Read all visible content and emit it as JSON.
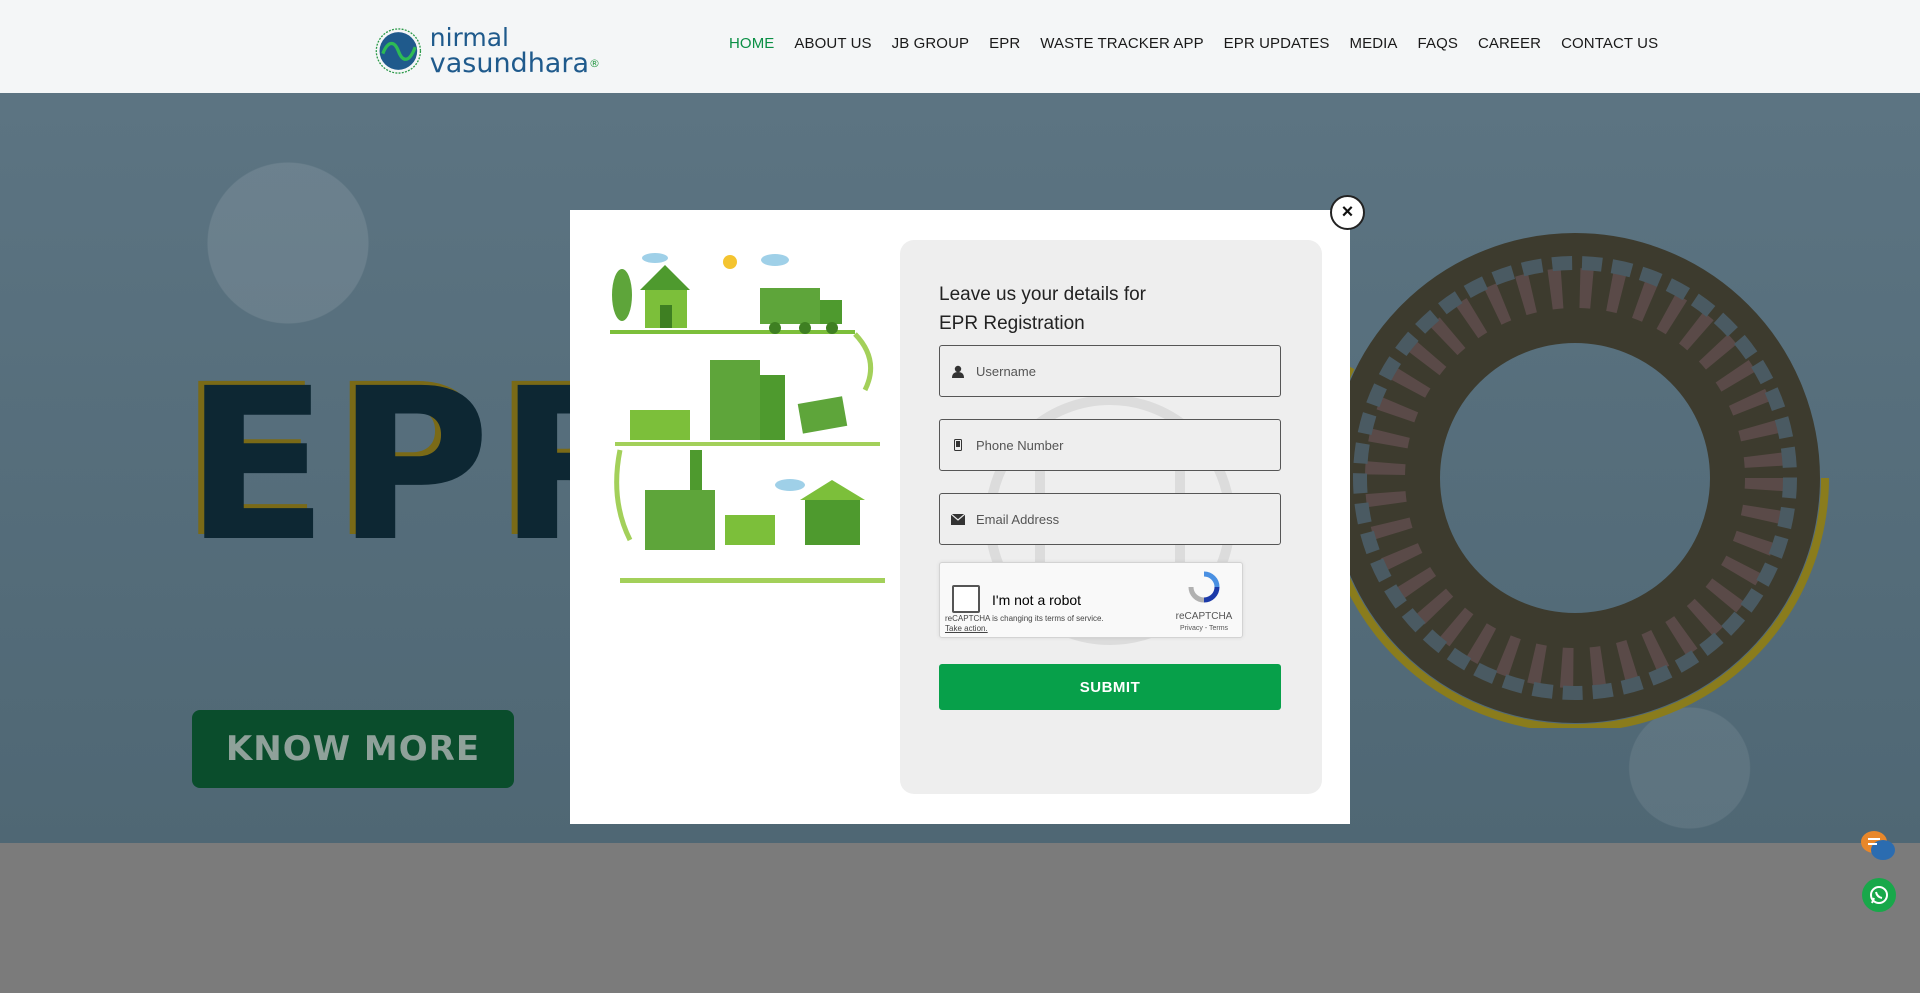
{
  "header": {
    "logo_line1": "nirmal",
    "logo_line2": "vasundhara",
    "logo_reg": "®",
    "nav": [
      {
        "label": "HOME",
        "active": true
      },
      {
        "label": "ABOUT US"
      },
      {
        "label": "JB GROUP"
      },
      {
        "label": "EPR"
      },
      {
        "label": "WASTE TRACKER APP"
      },
      {
        "label": "EPR UPDATES"
      },
      {
        "label": "MEDIA"
      },
      {
        "label": "FAQS"
      },
      {
        "label": "CAREER"
      },
      {
        "label": "CONTACT US"
      }
    ],
    "accent": "#0a8f45"
  },
  "hero": {
    "title": "EPR",
    "cta": "KNOW MORE"
  },
  "modal": {
    "close": "×",
    "title_line1": "Leave us your details for",
    "title_line2": "EPR Registration",
    "fields": {
      "username": {
        "placeholder": "Username",
        "icon": "user-icon"
      },
      "phone": {
        "placeholder": "Phone Number",
        "icon": "mobile-icon"
      },
      "email": {
        "placeholder": "Email Address",
        "icon": "envelope-icon"
      }
    },
    "captcha": {
      "label": "I'm not a robot",
      "notice": "reCAPTCHA is changing its terms of service.",
      "action": "Take action.",
      "brand": "reCAPTCHA",
      "terms": "Privacy - Terms"
    },
    "submit": "SUBMIT",
    "submit_color": "#07a04a"
  }
}
